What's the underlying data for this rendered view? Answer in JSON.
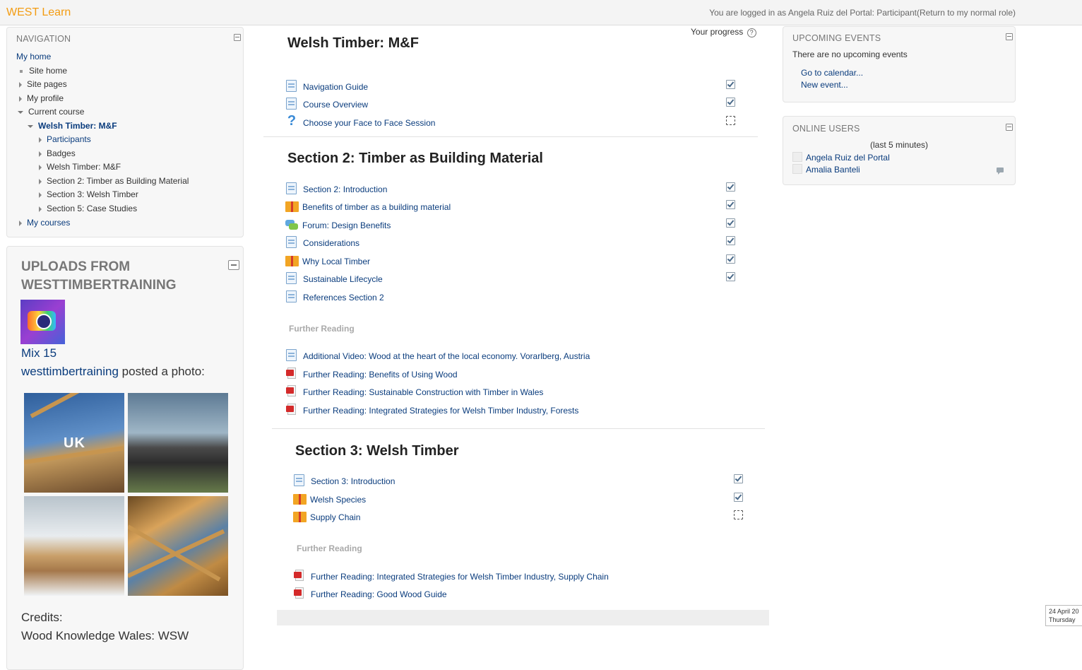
{
  "header": {
    "brand": "WEST Learn",
    "login_info": "You are logged in as Angela Ruiz del Portal: Participant(Return to my normal role)"
  },
  "navigation": {
    "title": "NAVIGATION",
    "items": [
      {
        "label": "My home"
      },
      {
        "label": "Site home"
      },
      {
        "label": "Site pages"
      },
      {
        "label": "My profile"
      },
      {
        "label": "Current course"
      },
      {
        "label": "Welsh Timber: M&F"
      },
      {
        "label": "Participants"
      },
      {
        "label": "Badges"
      },
      {
        "label": "Welsh Timber: M&F"
      },
      {
        "label": "Section 2: Timber as Building Material"
      },
      {
        "label": "Section 3: Welsh Timber"
      },
      {
        "label": "Section 5: Case Studies"
      },
      {
        "label": "My courses"
      }
    ]
  },
  "uploads": {
    "title": "UPLOADS FROM WESTTIMBERTRAINING",
    "mix_title": "Mix 15",
    "poster": "westtimbertraining",
    "posted_text": " posted a photo:",
    "photo_label": "UK",
    "credits_label": "Credits:",
    "credits_text": "Wood Knowledge Wales: WSW"
  },
  "course": {
    "progress_label": "Your progress",
    "progress_help": "?",
    "sections": [
      {
        "title": "Welsh Timber: M&F",
        "activities": [
          {
            "label": "Navigation Guide",
            "icon": "page-icon",
            "completed": true
          },
          {
            "label": "Course Overview",
            "icon": "page-icon",
            "completed": true
          },
          {
            "label": "Choose your Face to Face Session",
            "icon": "question-icon",
            "completed": false
          }
        ]
      },
      {
        "title": "Section 2: Timber as Building Material",
        "activities": [
          {
            "label": "Section 2: Introduction",
            "icon": "page-icon",
            "completed": true
          },
          {
            "label": "Benefits of timber as a building material",
            "icon": "book-icon",
            "completed": true
          },
          {
            "label": "Forum: Design Benefits",
            "icon": "forum-icon",
            "completed": true
          },
          {
            "label": "Considerations",
            "icon": "page-icon",
            "completed": true
          },
          {
            "label": "Why Local Timber",
            "icon": "book-icon",
            "completed": true
          },
          {
            "label": "Sustainable Lifecycle",
            "icon": "page-icon",
            "completed": true
          },
          {
            "label": "References Section 2",
            "icon": "page-icon",
            "completed": null
          }
        ],
        "further_label": "Further Reading",
        "further": [
          {
            "label": "Additional Video: Wood at the heart of the local economy. Vorarlberg, Austria",
            "icon": "page-icon"
          },
          {
            "label": "Further Reading: Benefits of Using Wood",
            "icon": "pdf-icon"
          },
          {
            "label": "Further Reading: Sustainable Construction with Timber in Wales",
            "icon": "pdf-icon"
          },
          {
            "label": "Further Reading: Integrated Strategies for Welsh Timber Industry, Forests",
            "icon": "pdf-icon"
          }
        ]
      },
      {
        "title": "Section 3: Welsh Timber",
        "activities": [
          {
            "label": "Section 3: Introduction",
            "icon": "page-icon",
            "completed": true
          },
          {
            "label": "Welsh Species",
            "icon": "book-icon",
            "completed": true
          },
          {
            "label": "Supply Chain",
            "icon": "book-icon",
            "completed": false
          }
        ],
        "further_label": "Further Reading",
        "further": [
          {
            "label": "Further Reading: Integrated Strategies for Welsh Timber Industry, Supply Chain",
            "icon": "pdf-icon"
          },
          {
            "label": "Further Reading: Good Wood Guide",
            "icon": "pdf-icon"
          }
        ]
      }
    ]
  },
  "events": {
    "title": "UPCOMING EVENTS",
    "empty_text": "There are no upcoming events",
    "go_calendar": "Go to calendar...",
    "new_event": "New event..."
  },
  "online_users": {
    "title": "ONLINE USERS",
    "timeframe": "(last 5 minutes)",
    "users": [
      "Angela Ruiz del Portal",
      "Amalia Banteli"
    ]
  },
  "date_widget": {
    "date": "24 April 20",
    "day": "Thursday"
  },
  "colors": {
    "brand": "#f39c12",
    "link": "#0a3c7d"
  }
}
